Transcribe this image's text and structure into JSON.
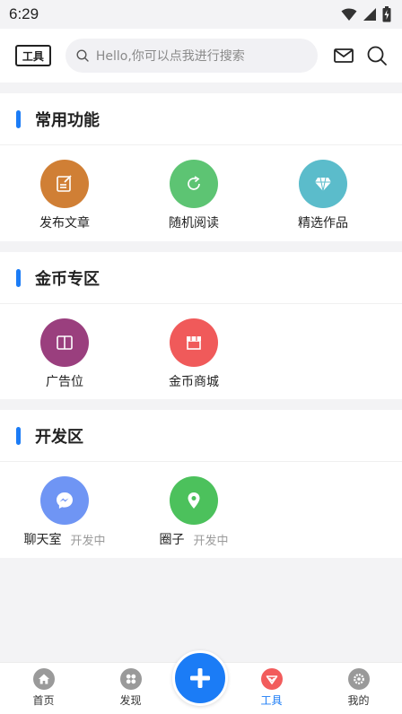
{
  "status_bar": {
    "time": "6:29"
  },
  "header": {
    "tool_label": "工具",
    "search_placeholder": "Hello,你可以点我进行搜索"
  },
  "sections": [
    {
      "title": "常用功能",
      "items": [
        {
          "label": "发布文章",
          "icon": "edit-icon",
          "color": "#d07f35"
        },
        {
          "label": "随机阅读",
          "icon": "refresh-icon",
          "color": "#5dc473"
        },
        {
          "label": "精选作品",
          "icon": "diamond-icon",
          "color": "#5bbccb"
        }
      ]
    },
    {
      "title": "金币专区",
      "items": [
        {
          "label": "广告位",
          "icon": "book-icon",
          "color": "#9a3f7e"
        },
        {
          "label": "金币商城",
          "icon": "store-icon",
          "color": "#f05a5a"
        }
      ]
    },
    {
      "title": "开发区",
      "items": [
        {
          "label": "聊天室",
          "sub": "开发中",
          "icon": "messenger-icon",
          "color": "#6f95f4"
        },
        {
          "label": "圈子",
          "sub": "开发中",
          "icon": "location-pin-icon",
          "color": "#4cc15c"
        }
      ]
    }
  ],
  "tabbar": {
    "items": [
      {
        "label": "首页",
        "icon": "home-icon"
      },
      {
        "label": "发现",
        "icon": "discover-icon"
      },
      {
        "label": "工具",
        "icon": "tools-icon",
        "active": true
      },
      {
        "label": "我的",
        "icon": "settings-icon"
      }
    ],
    "fab_icon": "plus-icon"
  },
  "colors": {
    "accent": "#1b7cf6",
    "background": "#f3f3f5",
    "tab_inactive_icon": "#9a9a9a",
    "tab_active_icon": "#f25c5c"
  }
}
